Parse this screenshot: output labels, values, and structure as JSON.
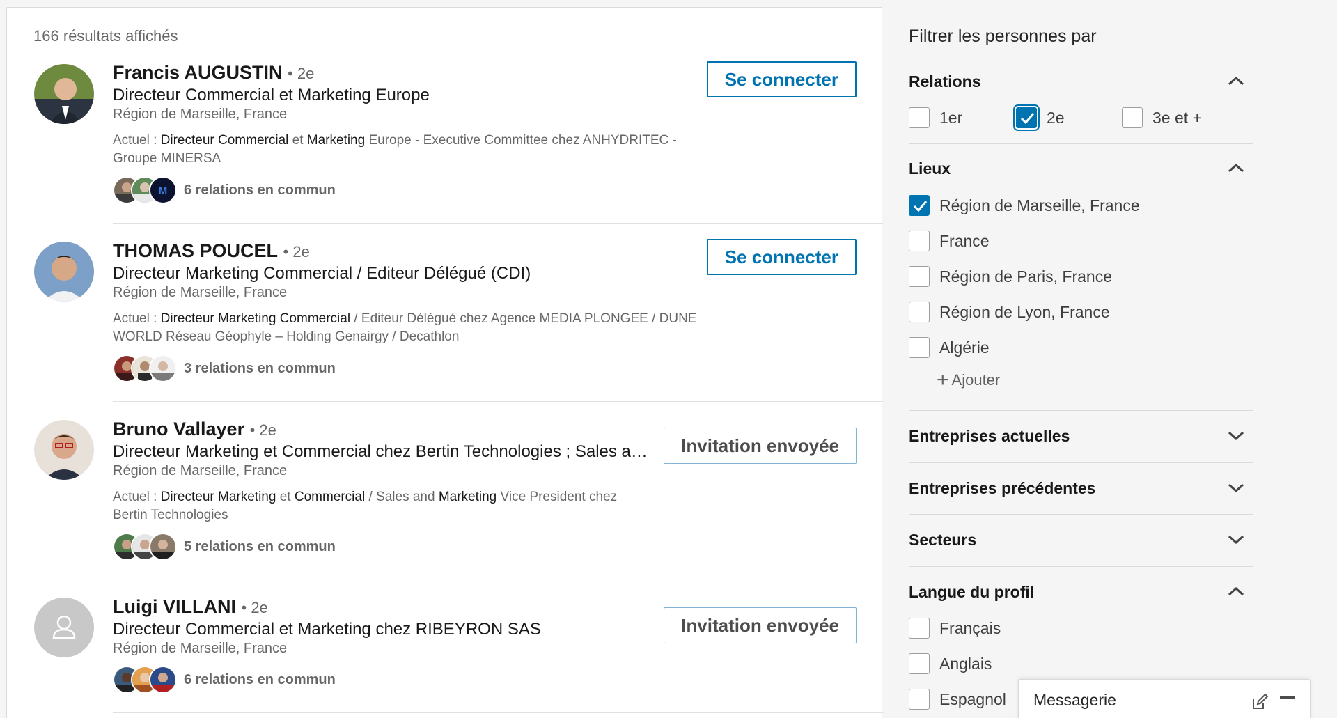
{
  "results": {
    "count_text": "166 résultats affichés",
    "items": [
      {
        "name": "Francis AUGUSTIN",
        "degree": "• 2e",
        "headline": "Directeur Commercial et Marketing Europe",
        "location": "Région de Marseille, France",
        "snippet_parts": [
          "Actuel : ",
          "Directeur Commercial",
          " et ",
          "Marketing",
          " Europe - Executive Committee chez ANHYDRITEC - Groupe MINERSA"
        ],
        "shared": "6 relations en commun",
        "action": "Se connecter",
        "action_type": "connect"
      },
      {
        "name": "THOMAS POUCEL",
        "degree": "• 2e",
        "headline": "Directeur Marketing Commercial / Editeur Délégué (CDI)",
        "location": "Région de Marseille, France",
        "snippet_parts": [
          "Actuel : ",
          "Directeur Marketing Commercial",
          " / Editeur Délégué chez Agence MEDIA PLONGEE / DUNE WORLD Réseau Géophyle – Holding Genairgy / Decathlon"
        ],
        "shared": "3 relations en commun",
        "action": "Se connecter",
        "action_type": "connect"
      },
      {
        "name": "Bruno Vallayer",
        "degree": "• 2e",
        "headline": "Directeur Marketing et Commercial chez Bertin Technologies ; Sales and M…",
        "location": "Région de Marseille, France",
        "snippet_parts": [
          "Actuel : ",
          "Directeur Marketing",
          " et ",
          "Commercial",
          " / Sales and ",
          "Marketing",
          " Vice President chez Bertin Technologies"
        ],
        "shared": "5 relations en commun",
        "action": "Invitation envoyée",
        "action_type": "sent"
      },
      {
        "name": "Luigi VILLANI",
        "degree": "• 2e",
        "headline": "Directeur Commercial et Marketing chez RIBEYRON SAS",
        "location": "Région de Marseille, France",
        "shared": "6 relations en commun",
        "action": "Invitation envoyée",
        "action_type": "sent"
      }
    ]
  },
  "filters": {
    "title": "Filtrer les personnes par",
    "relations": {
      "title": "Relations",
      "options": [
        {
          "label": "1er",
          "checked": false
        },
        {
          "label": "2e",
          "checked": true
        },
        {
          "label": "3e et +",
          "checked": false
        }
      ]
    },
    "lieux": {
      "title": "Lieux",
      "options": [
        {
          "label": "Région de Marseille, France",
          "checked": true
        },
        {
          "label": "France",
          "checked": false
        },
        {
          "label": "Région de Paris, France",
          "checked": false
        },
        {
          "label": "Région de Lyon, France",
          "checked": false
        },
        {
          "label": "Algérie",
          "checked": false
        }
      ],
      "add_label": "Ajouter"
    },
    "entreprises_actuelles": {
      "title": "Entreprises actuelles"
    },
    "entreprises_precedentes": {
      "title": "Entreprises précédentes"
    },
    "secteurs": {
      "title": "Secteurs"
    },
    "langue": {
      "title": "Langue du profil",
      "options": [
        {
          "label": "Français",
          "checked": false
        },
        {
          "label": "Anglais",
          "checked": false
        },
        {
          "label": "Espagnol",
          "checked": false
        }
      ]
    }
  },
  "messaging": {
    "label": "Messagerie"
  },
  "colors": {
    "accent": "#0073b1",
    "sent_border": "#7fb4d8"
  },
  "icons": [
    "chevron-up-icon",
    "chevron-down-icon",
    "check-icon",
    "plus-icon",
    "compose-icon",
    "minimize-icon",
    "default-avatar-icon"
  ]
}
